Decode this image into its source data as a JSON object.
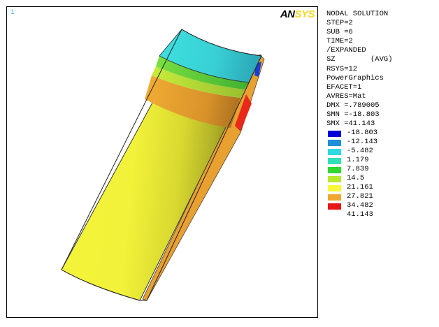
{
  "viewport": {
    "window_number": "1",
    "logo_part1": "AN",
    "logo_part2": "SYS"
  },
  "info_lines": [
    "NODAL SOLUTION",
    "STEP=2",
    "SUB =6",
    "TIME=2",
    "/EXPANDED",
    "SZ        (AVG)",
    "RSYS=12",
    "PowerGraphics",
    "EFACET=1",
    "AVRES=Mat",
    "DMX =.789005",
    "SMN =-18.803",
    "SMX =41.143"
  ],
  "legend": [
    {
      "label": "-18.803",
      "color": "#0000d8"
    },
    {
      "label": "-12.143",
      "color": "#1e90d8"
    },
    {
      "label": "-5.482",
      "color": "#30d8e0"
    },
    {
      "label": "1.179",
      "color": "#30e0b8"
    },
    {
      "label": "7.839",
      "color": "#30d830"
    },
    {
      "label": "14.5",
      "color": "#b8e830"
    },
    {
      "label": "21.161",
      "color": "#f8f838"
    },
    {
      "label": "27.821",
      "color": "#f0a830"
    },
    {
      "label": "34.482",
      "color": "#e81818"
    },
    {
      "label": "41.143",
      "color": null
    }
  ]
}
